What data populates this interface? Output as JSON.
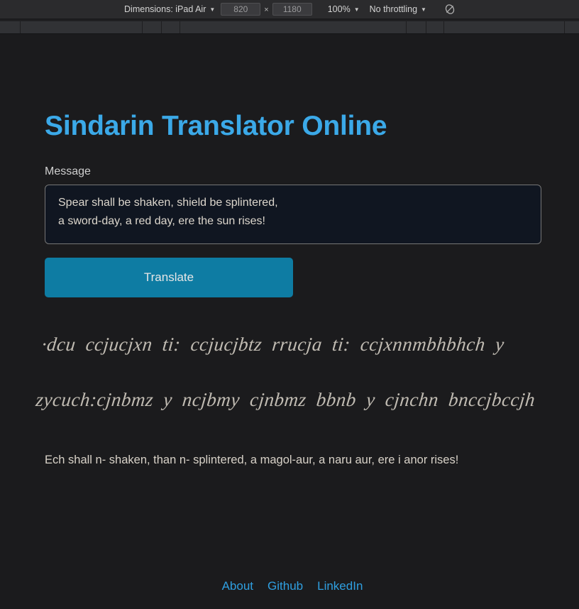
{
  "devtools": {
    "dimensions_label": "Dimensions: iPad Air",
    "width_value": "820",
    "times_symbol": "×",
    "height_value": "1180",
    "zoom_label": "100%",
    "throttling_label": "No throttling",
    "caret_glyph": "▼",
    "media_query_icon": "no-media-queries-icon"
  },
  "page": {
    "title": "Sindarin Translator Online",
    "title_color": "#3ba9e8",
    "background_color": "#1b1b1d",
    "form": {
      "message_label": "Message",
      "message_value": "Spear shall be shaken, shield be splintered,\na sword-day, a red day, ere the sun rises!",
      "message_placeholder": "",
      "translate_label": "Translate",
      "translate_color": "#0e7ca3"
    },
    "result": {
      "tengwar_script": "·dcu ccjucjxn ti: ccjucjbtz rrucja ti: ccjxnnmbhbhch y zycuch:cjnbmz y ncjbmy cjnbmz bbnb y cjnchn bnccjbccjh",
      "tengwar_color": "#cfc9bf",
      "translation": "Ech shall n- shaken, than n- splintered, a magol-aur, a naru aur, ere i anor rises!",
      "translation_color": "#d8d2c8"
    },
    "footer": {
      "links": [
        {
          "label": "About"
        },
        {
          "label": "Github"
        },
        {
          "label": "LinkedIn"
        }
      ],
      "link_color": "#2f9fe0"
    }
  }
}
